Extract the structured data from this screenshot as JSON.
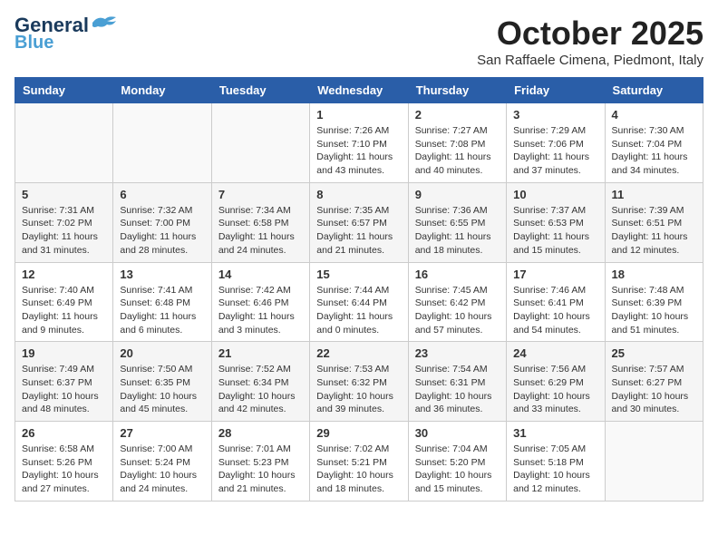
{
  "header": {
    "logo_line1": "General",
    "logo_line2": "Blue",
    "month": "October 2025",
    "location": "San Raffaele Cimena, Piedmont, Italy"
  },
  "weekdays": [
    "Sunday",
    "Monday",
    "Tuesday",
    "Wednesday",
    "Thursday",
    "Friday",
    "Saturday"
  ],
  "weeks": [
    [
      {
        "day": "",
        "info": ""
      },
      {
        "day": "",
        "info": ""
      },
      {
        "day": "",
        "info": ""
      },
      {
        "day": "1",
        "info": "Sunrise: 7:26 AM\nSunset: 7:10 PM\nDaylight: 11 hours\nand 43 minutes."
      },
      {
        "day": "2",
        "info": "Sunrise: 7:27 AM\nSunset: 7:08 PM\nDaylight: 11 hours\nand 40 minutes."
      },
      {
        "day": "3",
        "info": "Sunrise: 7:29 AM\nSunset: 7:06 PM\nDaylight: 11 hours\nand 37 minutes."
      },
      {
        "day": "4",
        "info": "Sunrise: 7:30 AM\nSunset: 7:04 PM\nDaylight: 11 hours\nand 34 minutes."
      }
    ],
    [
      {
        "day": "5",
        "info": "Sunrise: 7:31 AM\nSunset: 7:02 PM\nDaylight: 11 hours\nand 31 minutes."
      },
      {
        "day": "6",
        "info": "Sunrise: 7:32 AM\nSunset: 7:00 PM\nDaylight: 11 hours\nand 28 minutes."
      },
      {
        "day": "7",
        "info": "Sunrise: 7:34 AM\nSunset: 6:58 PM\nDaylight: 11 hours\nand 24 minutes."
      },
      {
        "day": "8",
        "info": "Sunrise: 7:35 AM\nSunset: 6:57 PM\nDaylight: 11 hours\nand 21 minutes."
      },
      {
        "day": "9",
        "info": "Sunrise: 7:36 AM\nSunset: 6:55 PM\nDaylight: 11 hours\nand 18 minutes."
      },
      {
        "day": "10",
        "info": "Sunrise: 7:37 AM\nSunset: 6:53 PM\nDaylight: 11 hours\nand 15 minutes."
      },
      {
        "day": "11",
        "info": "Sunrise: 7:39 AM\nSunset: 6:51 PM\nDaylight: 11 hours\nand 12 minutes."
      }
    ],
    [
      {
        "day": "12",
        "info": "Sunrise: 7:40 AM\nSunset: 6:49 PM\nDaylight: 11 hours\nand 9 minutes."
      },
      {
        "day": "13",
        "info": "Sunrise: 7:41 AM\nSunset: 6:48 PM\nDaylight: 11 hours\nand 6 minutes."
      },
      {
        "day": "14",
        "info": "Sunrise: 7:42 AM\nSunset: 6:46 PM\nDaylight: 11 hours\nand 3 minutes."
      },
      {
        "day": "15",
        "info": "Sunrise: 7:44 AM\nSunset: 6:44 PM\nDaylight: 11 hours\nand 0 minutes."
      },
      {
        "day": "16",
        "info": "Sunrise: 7:45 AM\nSunset: 6:42 PM\nDaylight: 10 hours\nand 57 minutes."
      },
      {
        "day": "17",
        "info": "Sunrise: 7:46 AM\nSunset: 6:41 PM\nDaylight: 10 hours\nand 54 minutes."
      },
      {
        "day": "18",
        "info": "Sunrise: 7:48 AM\nSunset: 6:39 PM\nDaylight: 10 hours\nand 51 minutes."
      }
    ],
    [
      {
        "day": "19",
        "info": "Sunrise: 7:49 AM\nSunset: 6:37 PM\nDaylight: 10 hours\nand 48 minutes."
      },
      {
        "day": "20",
        "info": "Sunrise: 7:50 AM\nSunset: 6:35 PM\nDaylight: 10 hours\nand 45 minutes."
      },
      {
        "day": "21",
        "info": "Sunrise: 7:52 AM\nSunset: 6:34 PM\nDaylight: 10 hours\nand 42 minutes."
      },
      {
        "day": "22",
        "info": "Sunrise: 7:53 AM\nSunset: 6:32 PM\nDaylight: 10 hours\nand 39 minutes."
      },
      {
        "day": "23",
        "info": "Sunrise: 7:54 AM\nSunset: 6:31 PM\nDaylight: 10 hours\nand 36 minutes."
      },
      {
        "day": "24",
        "info": "Sunrise: 7:56 AM\nSunset: 6:29 PM\nDaylight: 10 hours\nand 33 minutes."
      },
      {
        "day": "25",
        "info": "Sunrise: 7:57 AM\nSunset: 6:27 PM\nDaylight: 10 hours\nand 30 minutes."
      }
    ],
    [
      {
        "day": "26",
        "info": "Sunrise: 6:58 AM\nSunset: 5:26 PM\nDaylight: 10 hours\nand 27 minutes."
      },
      {
        "day": "27",
        "info": "Sunrise: 7:00 AM\nSunset: 5:24 PM\nDaylight: 10 hours\nand 24 minutes."
      },
      {
        "day": "28",
        "info": "Sunrise: 7:01 AM\nSunset: 5:23 PM\nDaylight: 10 hours\nand 21 minutes."
      },
      {
        "day": "29",
        "info": "Sunrise: 7:02 AM\nSunset: 5:21 PM\nDaylight: 10 hours\nand 18 minutes."
      },
      {
        "day": "30",
        "info": "Sunrise: 7:04 AM\nSunset: 5:20 PM\nDaylight: 10 hours\nand 15 minutes."
      },
      {
        "day": "31",
        "info": "Sunrise: 7:05 AM\nSunset: 5:18 PM\nDaylight: 10 hours\nand 12 minutes."
      },
      {
        "day": "",
        "info": ""
      }
    ]
  ]
}
